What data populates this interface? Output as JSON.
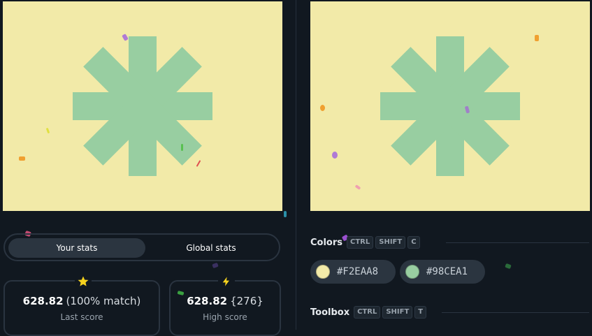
{
  "shape_colors": {
    "background": "#F2EAA8",
    "foreground": "#98CEA1"
  },
  "stats": {
    "tabs": [
      {
        "label": "Your stats",
        "active": true
      },
      {
        "label": "Global stats",
        "active": false
      }
    ],
    "last": {
      "value": "628.82",
      "extra": "(100% match)",
      "label": "Last score",
      "icon": "star-icon"
    },
    "high": {
      "value": "628.82",
      "extra": "{276}",
      "label": "High score",
      "icon": "lightning-icon"
    }
  },
  "colors_section": {
    "title": "Colors",
    "shortcut": [
      "CTRL",
      "SHIFT",
      "C"
    ],
    "swatches": [
      {
        "hex": "#F2EAA8",
        "label": "#F2EAA8"
      },
      {
        "hex": "#98CEA1",
        "label": "#98CEA1"
      }
    ]
  },
  "toolbox_section": {
    "title": "Toolbox",
    "shortcut": [
      "CTRL",
      "SHIFT",
      "T"
    ]
  },
  "accent_colors": {
    "star": "#F5D21E",
    "bolt": "#F5D21E",
    "panel": "#111820",
    "chip": "#2B3540"
  }
}
